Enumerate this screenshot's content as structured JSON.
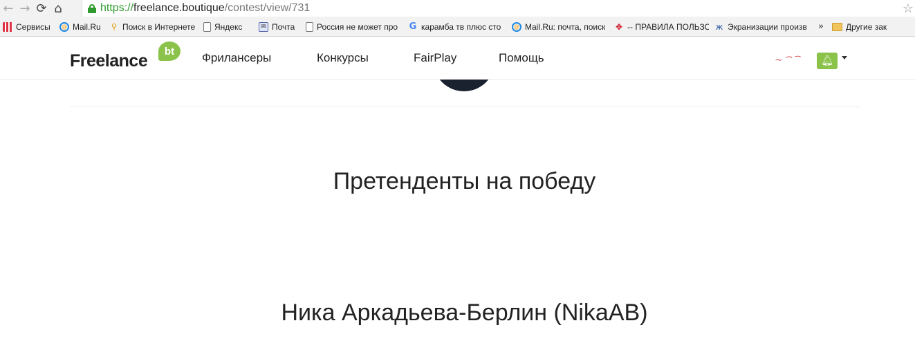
{
  "browser": {
    "url_scheme": "https://",
    "url_host": "freelance.boutique",
    "url_path": "/contest/view/731",
    "back_icon": "arrow-left-icon",
    "forward_icon": "arrow-right-icon",
    "reload_icon": "reload-icon",
    "home_icon": "home-icon",
    "bookmark_star_icon": "star-icon"
  },
  "bookmarks": [
    {
      "label": "Сервисы",
      "icon": "apps-grid-icon"
    },
    {
      "label": "Mail.Ru",
      "icon": "mailru-icon"
    },
    {
      "label": "Поиск в Интернете",
      "icon": "search-icon"
    },
    {
      "label": "Яндекс",
      "icon": "page-icon"
    },
    {
      "label": "Почта",
      "icon": "mail-icon"
    },
    {
      "label": "Россия не может про",
      "icon": "page-icon"
    },
    {
      "label": "карамба тв плюс сто",
      "icon": "google-icon"
    },
    {
      "label": "Mail.Ru: почта, поиск",
      "icon": "mailru-icon"
    },
    {
      "label": "-- ПРАВИЛА ПОЛЬЗО",
      "icon": "multicolor-icon"
    },
    {
      "label": "Экранизации произв",
      "icon": "butterfly-icon"
    }
  ],
  "bookmarks_more": "»",
  "other_bookmarks": "Другие зак",
  "site": {
    "logo_text": "Freelance",
    "logo_badge": "bt",
    "nav": [
      "Фриланcеры",
      "Конкурсы",
      "FairPlay",
      "Помощь"
    ],
    "accent_color": "#8bc34a"
  },
  "content": {
    "section_title": "Претенденты на победу",
    "winner_name": "Ника Аркадьева-Берлин (NikaAB)"
  }
}
